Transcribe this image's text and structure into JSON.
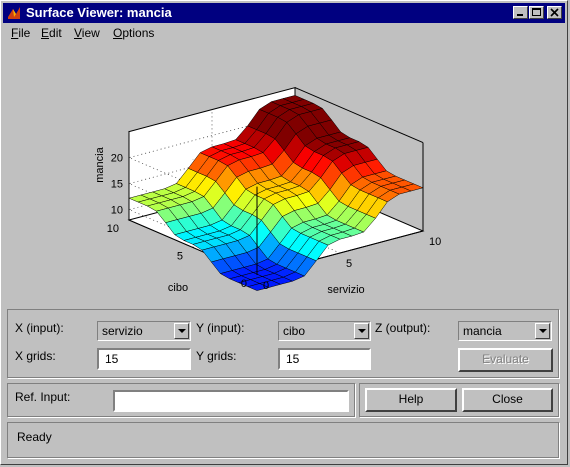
{
  "window": {
    "title": "Surface Viewer: mancia"
  },
  "menu": [
    {
      "label": "File",
      "underline": "F",
      "rest": "ile"
    },
    {
      "label": "Edit",
      "underline": "E",
      "rest": "dit"
    },
    {
      "label": "View",
      "underline": "V",
      "rest": "iew"
    },
    {
      "label": "Options",
      "underline": "O",
      "rest": "ptions"
    }
  ],
  "plot": {
    "zlabel": "mancia",
    "xlabel": "servizio",
    "ylabel": "cibo",
    "z_ticks": [
      "20",
      "15",
      "10"
    ],
    "x_ticks": [
      "0",
      "5",
      "10"
    ],
    "y_ticks": [
      "10",
      "5",
      "0"
    ],
    "grid_points": 15,
    "colormap": "jet (blue to yellow)"
  },
  "controls": {
    "x_input_label": "X (input):",
    "x_input_value": "servizio",
    "y_input_label": "Y (input):",
    "y_input_value": "cibo",
    "z_output_label": "Z (output):",
    "z_output_value": "mancia",
    "x_grids_label": "X grids:",
    "x_grids_value": "15",
    "y_grids_label": "Y grids:",
    "y_grids_value": "15",
    "evaluate_label": "Evaluate",
    "ref_input_label": "Ref. Input:",
    "ref_input_value": "",
    "help_label": "Help",
    "close_label": "Close"
  },
  "status": {
    "text": "Ready"
  }
}
